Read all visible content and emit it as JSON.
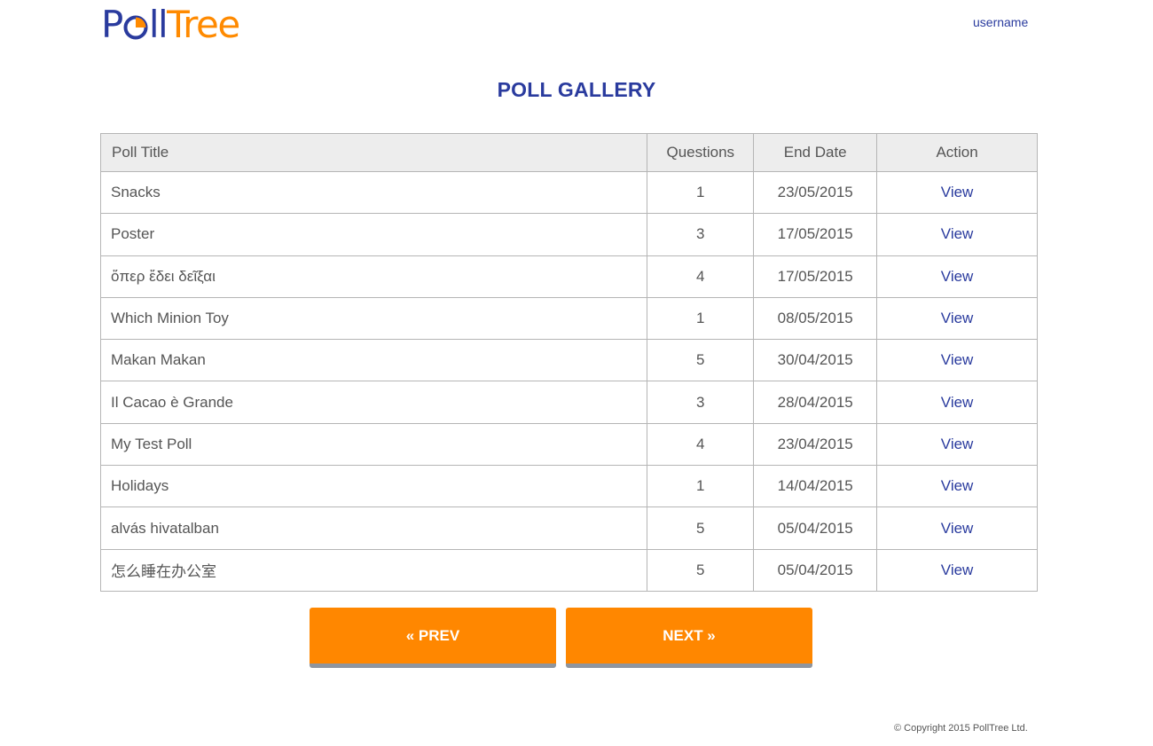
{
  "header": {
    "logo": {
      "part1": "P",
      "part2": "ll",
      "part3": "Tree"
    },
    "user_link": "username"
  },
  "page_title": "POLL GALLERY",
  "table": {
    "headers": [
      "Poll Title",
      "Questions",
      "End Date",
      "Action"
    ],
    "rows": [
      {
        "title": "Snacks",
        "questions": "1",
        "end_date": "23/05/2015",
        "action": "View"
      },
      {
        "title": "Poster",
        "questions": "3",
        "end_date": "17/05/2015",
        "action": "View"
      },
      {
        "title": "ὅπερ ἔδει δεῖξαι",
        "questions": "4",
        "end_date": "17/05/2015",
        "action": "View"
      },
      {
        "title": "Which Minion Toy",
        "questions": "1",
        "end_date": "08/05/2015",
        "action": "View"
      },
      {
        "title": "Makan Makan",
        "questions": "5",
        "end_date": "30/04/2015",
        "action": "View"
      },
      {
        "title": "Il Cacao è Grande",
        "questions": "3",
        "end_date": "28/04/2015",
        "action": "View"
      },
      {
        "title": "My Test Poll",
        "questions": "4",
        "end_date": "23/04/2015",
        "action": "View"
      },
      {
        "title": "Holidays",
        "questions": "1",
        "end_date": "14/04/2015",
        "action": "View"
      },
      {
        "title": "alvás hivatalban",
        "questions": "5",
        "end_date": "05/04/2015",
        "action": "View"
      },
      {
        "title": "怎么睡在办公室",
        "questions": "5",
        "end_date": "05/04/2015",
        "action": "View"
      }
    ]
  },
  "pager": {
    "prev_label": "« PREV",
    "next_label": "NEXT »"
  },
  "footer": {
    "copyright": "© Copyright 2015 PollTree Ltd."
  },
  "colors": {
    "brand_blue": "#2a3b9e",
    "brand_orange": "#ff8700",
    "header_bg": "#ededed"
  }
}
